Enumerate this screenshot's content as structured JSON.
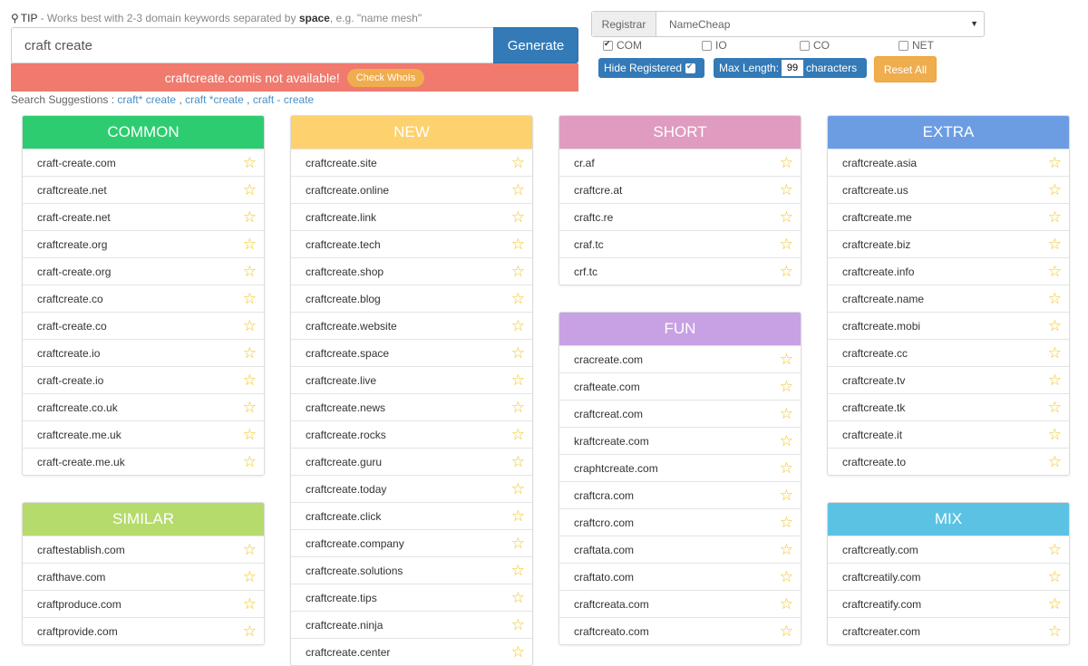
{
  "tip": {
    "label": "TIP",
    "text_before": " - Works best with 2-3 domain keywords separated by ",
    "bold": "space",
    "text_after": ", e.g. \"name mesh\""
  },
  "search": {
    "value": "craft create",
    "button": "Generate"
  },
  "alert": {
    "domain": "craftcreate.com",
    "message": " is not available!",
    "whois_button": "Check WhoIs"
  },
  "suggestions": {
    "label": "Search Suggestions : ",
    "items": [
      "craft* create",
      "craft *create",
      "craft - create"
    ]
  },
  "registrar": {
    "label": "Registrar",
    "value": "NameCheap"
  },
  "tlds": [
    {
      "label": "COM",
      "checked": true
    },
    {
      "label": "IO",
      "checked": false
    },
    {
      "label": "CO",
      "checked": false
    },
    {
      "label": "NET",
      "checked": false
    }
  ],
  "controls": {
    "hide_registered": "Hide Registered",
    "max_length_label": "Max Length:",
    "max_length_value": "99",
    "characters": "characters",
    "reset": "Reset All"
  },
  "colors": {
    "common": "#2ecc71",
    "new": "#fcd16e",
    "short": "#df9bc0",
    "extra": "#6c9de3",
    "similar": "#b5db6c",
    "fun": "#c8a0e4",
    "mix": "#5bc2e4",
    "primary": "#337ab7",
    "warning": "#f0ad4e",
    "danger": "#ef7a6d"
  },
  "panels": {
    "common": {
      "title": "COMMON",
      "items": [
        "craft-create.com",
        "craftcreate.net",
        "craft-create.net",
        "craftcreate.org",
        "craft-create.org",
        "craftcreate.co",
        "craft-create.co",
        "craftcreate.io",
        "craft-create.io",
        "craftcreate.co.uk",
        "craftcreate.me.uk",
        "craft-create.me.uk"
      ]
    },
    "similar": {
      "title": "SIMILAR",
      "items": [
        "craftestablish.com",
        "crafthave.com",
        "craftproduce.com",
        "craftprovide.com"
      ]
    },
    "new": {
      "title": "NEW",
      "items": [
        "craftcreate.site",
        "craftcreate.online",
        "craftcreate.link",
        "craftcreate.tech",
        "craftcreate.shop",
        "craftcreate.blog",
        "craftcreate.website",
        "craftcreate.space",
        "craftcreate.live",
        "craftcreate.news",
        "craftcreate.rocks",
        "craftcreate.guru",
        "craftcreate.today",
        "craftcreate.click",
        "craftcreate.company",
        "craftcreate.solutions",
        "craftcreate.tips",
        "craftcreate.ninja",
        "craftcreate.center"
      ]
    },
    "short": {
      "title": "SHORT",
      "items": [
        "cr.af",
        "craftcre.at",
        "craftc.re",
        "craf.tc",
        "crf.tc"
      ]
    },
    "fun": {
      "title": "FUN",
      "items": [
        "cracreate.com",
        "crafteate.com",
        "craftcreat.com",
        "kraftcreate.com",
        "craphtcreate.com",
        "craftcra.com",
        "craftcro.com",
        "craftata.com",
        "craftato.com",
        "craftcreata.com",
        "craftcreato.com"
      ]
    },
    "extra": {
      "title": "EXTRA",
      "items": [
        "craftcreate.asia",
        "craftcreate.us",
        "craftcreate.me",
        "craftcreate.biz",
        "craftcreate.info",
        "craftcreate.name",
        "craftcreate.mobi",
        "craftcreate.cc",
        "craftcreate.tv",
        "craftcreate.tk",
        "craftcreate.it",
        "craftcreate.to"
      ]
    },
    "mix": {
      "title": "MIX",
      "items": [
        "craftcreatly.com",
        "craftcreatily.com",
        "craftcreatify.com",
        "craftcreater.com"
      ]
    }
  }
}
